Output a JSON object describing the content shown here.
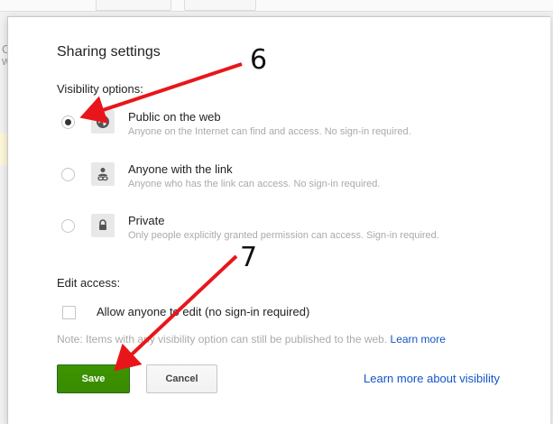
{
  "background": {
    "accent": "#fafafa"
  },
  "dialog": {
    "title": "Sharing settings",
    "visibility_label": "Visibility options:",
    "options": [
      {
        "title": "Public on the web",
        "description": "Anyone on the Internet can find and access. No sign-in required.",
        "icon": "globe-icon",
        "selected": true
      },
      {
        "title": "Anyone with the link",
        "description": "Anyone who has the link can access. No sign-in required.",
        "icon": "person-link-icon",
        "selected": false
      },
      {
        "title": "Private",
        "description": "Only people explicitly granted permission can access. Sign-in required.",
        "icon": "lock-icon",
        "selected": false
      }
    ],
    "edit_access_label": "Edit access:",
    "allow_edit_label": "Allow anyone to edit (no sign-in required)",
    "allow_edit_checked": false,
    "note": "Note: Items with any visibility option can still be published to the web.",
    "note_link": "Learn more",
    "save_label": "Save",
    "cancel_label": "Cancel",
    "learn_visibility": "Learn more about visibility"
  },
  "annotations": {
    "step_6": "6",
    "step_7": "7",
    "arrow_color": "#e8161a"
  },
  "colors": {
    "save_green": "#3d9400",
    "link_blue": "#1155cc"
  }
}
